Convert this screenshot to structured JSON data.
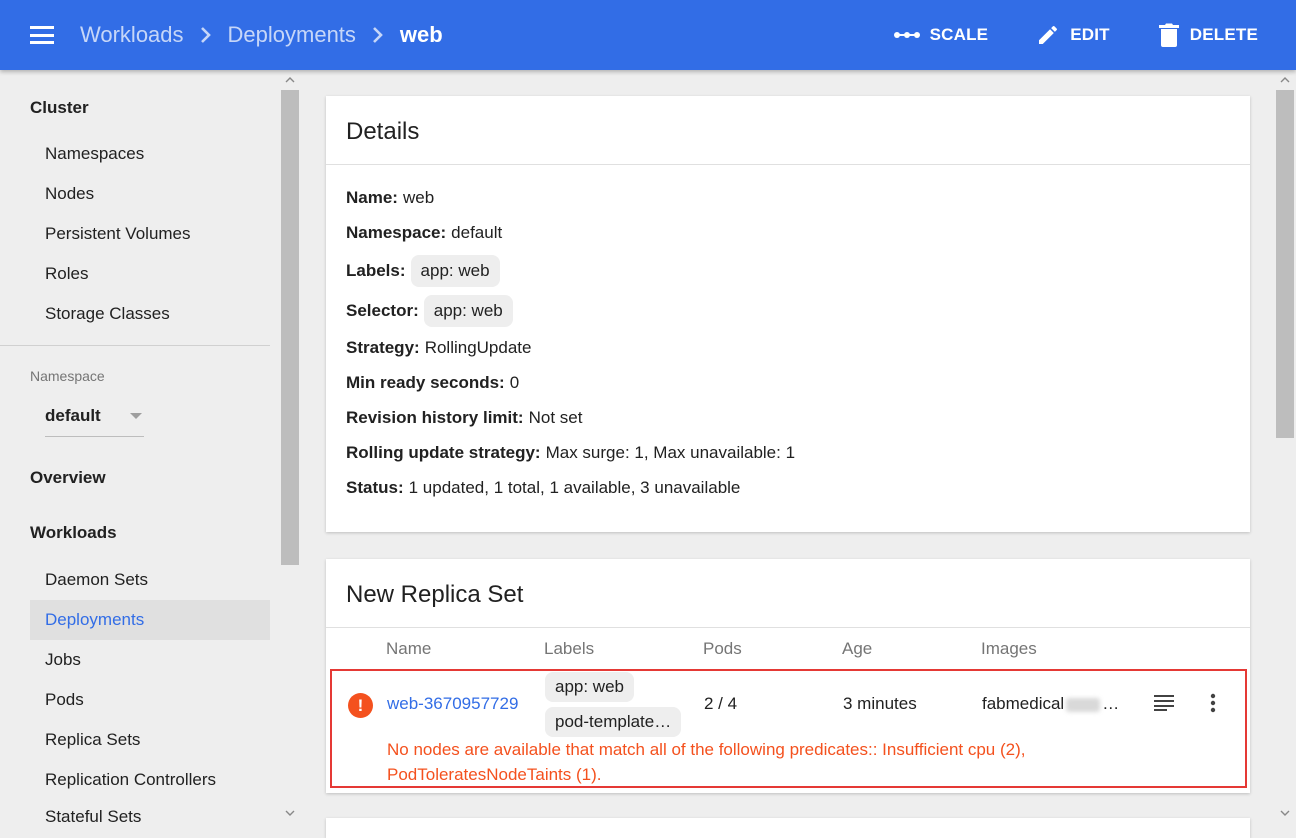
{
  "header": {
    "menu_icon": "menu-icon",
    "breadcrumb": [
      "Workloads",
      "Deployments",
      "web"
    ],
    "actions": [
      {
        "label": "SCALE",
        "icon": "scale-icon"
      },
      {
        "label": "EDIT",
        "icon": "pencil-icon"
      },
      {
        "label": "DELETE",
        "icon": "trash-icon"
      }
    ],
    "brand_color": "#326de6"
  },
  "sidebar": {
    "cluster_heading": "Cluster",
    "cluster_items": [
      "Namespaces",
      "Nodes",
      "Persistent Volumes",
      "Roles",
      "Storage Classes"
    ],
    "namespace_label": "Namespace",
    "namespace_value": "default",
    "overview": "Overview",
    "workloads_heading": "Workloads",
    "workload_items": [
      "Daemon Sets",
      "Deployments",
      "Jobs",
      "Pods",
      "Replica Sets",
      "Replication Controllers",
      "Stateful Sets"
    ],
    "active_item": "Deployments"
  },
  "details": {
    "title": "Details",
    "name_key": "Name:",
    "name_val": "web",
    "namespace_key": "Namespace:",
    "namespace_val": "default",
    "labels_key": "Labels:",
    "labels_chip": "app: web",
    "selector_key": "Selector:",
    "selector_chip": "app: web",
    "strategy_key": "Strategy:",
    "strategy_val": "RollingUpdate",
    "minready_key": "Min ready seconds:",
    "minready_val": "0",
    "revision_key": "Revision history limit:",
    "revision_val": "Not set",
    "rolling_key": "Rolling update strategy:",
    "rolling_val": "Max surge: 1, Max unavailable: 1",
    "status_key": "Status:",
    "status_val": "1 updated, 1 total, 1 available, 3 unavailable"
  },
  "replica_set": {
    "title": "New Replica Set",
    "columns": [
      "Name",
      "Labels",
      "Pods",
      "Age",
      "Images"
    ],
    "row": {
      "name": "web-3670957729",
      "labels": [
        "app: web",
        "pod-template…"
      ],
      "pods": "2 / 4",
      "age": "3 minutes",
      "image_prefix": "fabmedical",
      "image_suffix": "…",
      "status_icon": "warning-icon",
      "error_line1": "No nodes are available that match all of the following predicates:: Insufficient cpu (2),",
      "error_line2": "PodToleratesNodeTaints (1).",
      "error_color": "#f4511e"
    }
  }
}
